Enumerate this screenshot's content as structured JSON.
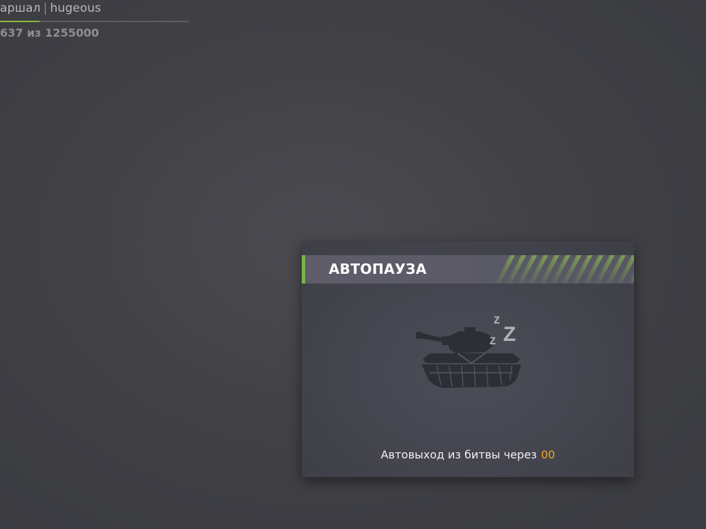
{
  "player": {
    "rank_fragment": "аршал",
    "separator": "|",
    "nickname": "hugeous",
    "progress_fraction": 0.21
  },
  "score": {
    "text": "637 из 1255000"
  },
  "autopause": {
    "title": "АВТОПАУЗА",
    "icon": "sleeping-tank-icon",
    "zzz": [
      "z",
      "z",
      "Z"
    ],
    "exit_label": "Автовыход из битвы через",
    "countdown": "00"
  },
  "colors": {
    "accent_green": "#7db446",
    "progress_green": "#8dba3c",
    "countdown_orange": "#f2a922",
    "title_white": "#ffffff"
  }
}
